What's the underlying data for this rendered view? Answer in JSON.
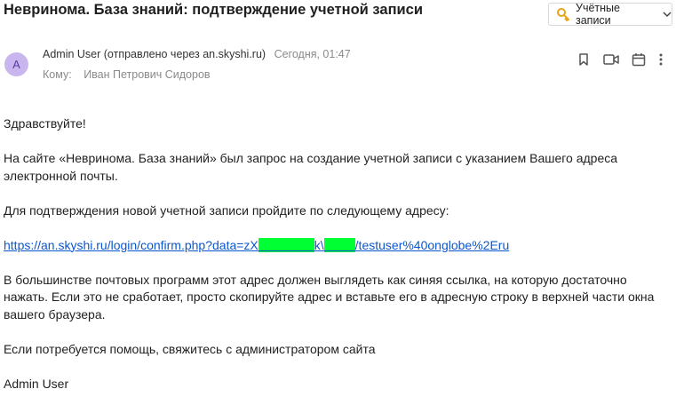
{
  "email": {
    "subject": "Невринома. База знаний: подтверждение учетной записи",
    "sender": {
      "avatar_letter": "A",
      "avatar_color": "#c9b6ee",
      "name_line": "Admin User (отправлено через an.skyshi.ru)",
      "time": "Сегодня, 01:47"
    },
    "to": {
      "label": "Кому:",
      "name": "Иван Петрович Сидоров"
    },
    "body": {
      "greeting": "Здравствуйте!",
      "p1": "На сайте «Невринома. База знаний» был запрос на создание учетной записи с указанием Вашего адреса электронной почты.",
      "p2": "Для подтверждения новой учетной записи пройдите по следующему адресу:",
      "link_part1": "https://an.skyshi.ru/login/confirm.php?data=zX",
      "link_mask1": "xxxxxxxxx",
      "link_part2": "k\\",
      "link_mask2": "xxxxx",
      "link_part3": "/testuser%40onglobe%2Eru",
      "p3": "В большинстве почтовых программ этот адрес должен выглядеть как синяя ссылка, на которую достаточно нажать. Если это не сработает, просто скопируйте адрес и вставьте его в адресную строку в верхней части окна вашего браузера.",
      "p4": "Если потребуется помощь, свяжитесь с администратором сайта",
      "signature": "Admin User"
    }
  },
  "toolbar": {
    "accounts_label": "Учётные записи"
  },
  "icons": {
    "key": "key-icon",
    "chevron": "chevron-down-icon",
    "bookmark": "bookmark-icon",
    "video": "video-icon",
    "calendar": "calendar-icon",
    "more": "more-vertical-icon"
  },
  "colors": {
    "link": "#0b57d0",
    "redaction": "#00ff33",
    "key_icon": "#e8a317"
  }
}
